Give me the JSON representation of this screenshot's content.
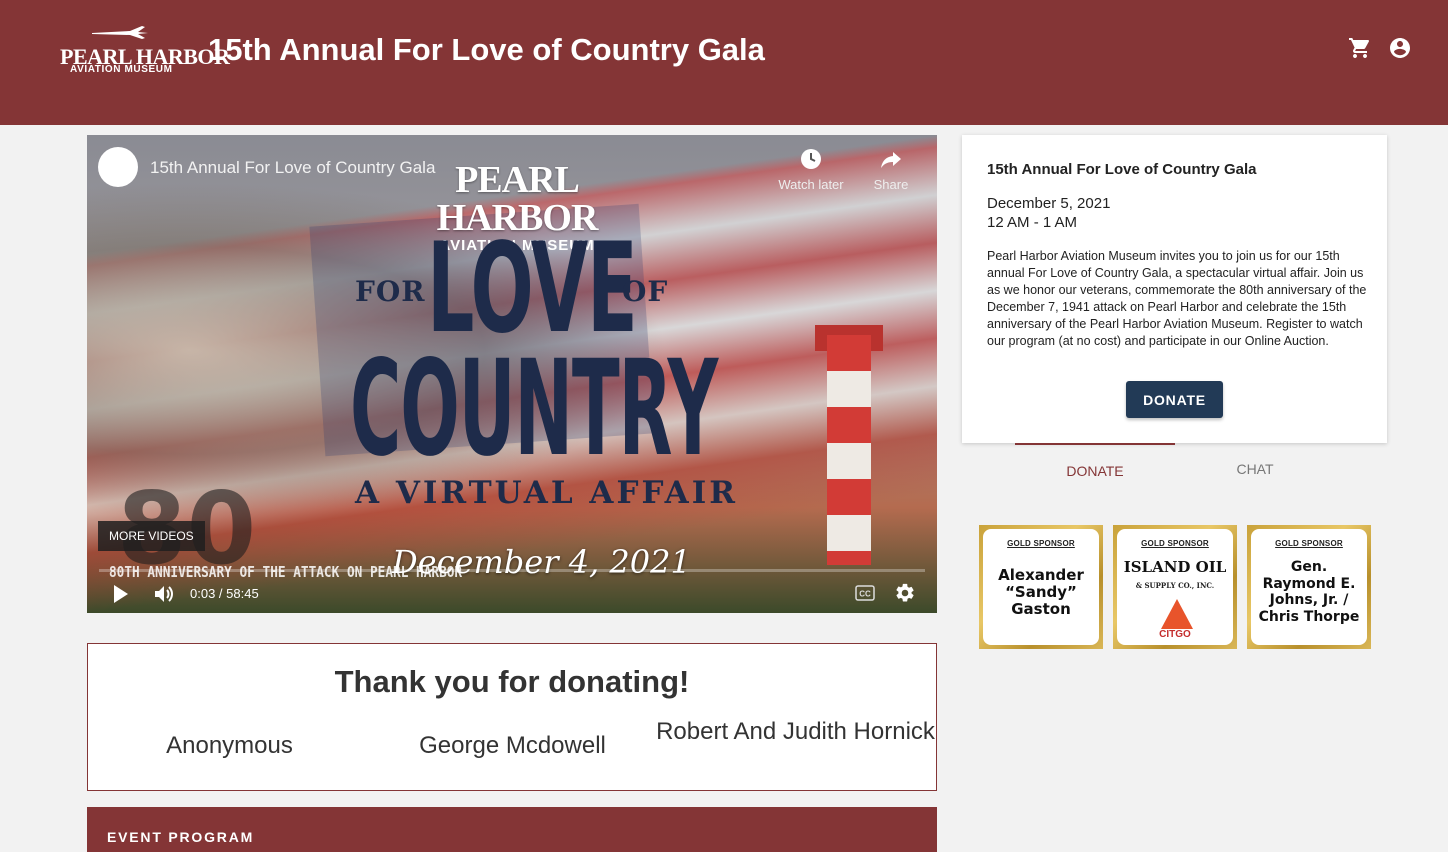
{
  "header": {
    "logo_line1": "PEARL HARBOR",
    "logo_line2": "AVIATION MUSEUM",
    "title": "15th Annual For Love of Country Gala",
    "background_color": "#843536",
    "icons": [
      "shopping-cart-icon",
      "account-circle-icon"
    ]
  },
  "video": {
    "title": "15th Annual For Love of Country Gala",
    "watch_later_label": "Watch later",
    "share_label": "Share",
    "more_videos_label": "MORE VIDEOS",
    "time": "0:03 / 58:45",
    "thumbnail": {
      "logo_line1": "PEARL HARBOR",
      "logo_line2": "AVIATION MUSEUM",
      "for": "FOR",
      "love": "LOVE",
      "of": "OF",
      "country": "COUNTRY",
      "virtual_affair": "A VIRTUAL AFFAIR",
      "date": "December 4, 2021",
      "eighty": "80",
      "anniversary": "80TH ANNIVERSARY OF THE ATTACK ON PEARL HARBOR"
    }
  },
  "event": {
    "title": "15th Annual For Love of Country Gala",
    "date": "December 5, 2021",
    "time": "12 AM - 1 AM",
    "description": "Pearl Harbor Aviation Museum invites you to join us for our 15th annual For Love of Country Gala, a spectacular virtual affair. Join us as we honor our veterans, commemorate the 80th anniversary of the December 7, 1941 attack on Pearl Harbor and celebrate the 15th anniversary of the Pearl Harbor Aviation Museum. Register to watch our program (at no cost) and participate in our Online Auction.",
    "donate_button": "DONATE"
  },
  "tabs": [
    {
      "label": "DONATE",
      "active": true
    },
    {
      "label": "CHAT",
      "active": false
    }
  ],
  "sponsors": [
    {
      "tier": "GOLD SPONSOR",
      "name": "Alexander “Sandy” Gaston"
    },
    {
      "tier": "GOLD SPONSOR",
      "name": "ISLAND OIL",
      "sub": "& SUPPLY CO., INC.",
      "brand": "CITGO"
    },
    {
      "tier": "GOLD SPONSOR",
      "name": "Gen. Raymond E. Johns, Jr. / Chris Thorpe"
    }
  ],
  "thanks": {
    "title": "Thank you for donating!",
    "donors": [
      "Anonymous",
      "George Mcdowell",
      "Robert And Judith Hornick"
    ]
  },
  "program": {
    "label": "EVENT PROGRAM"
  },
  "colors": {
    "brand": "#843536",
    "button": "#223a56",
    "gold": "#d4af4a"
  }
}
